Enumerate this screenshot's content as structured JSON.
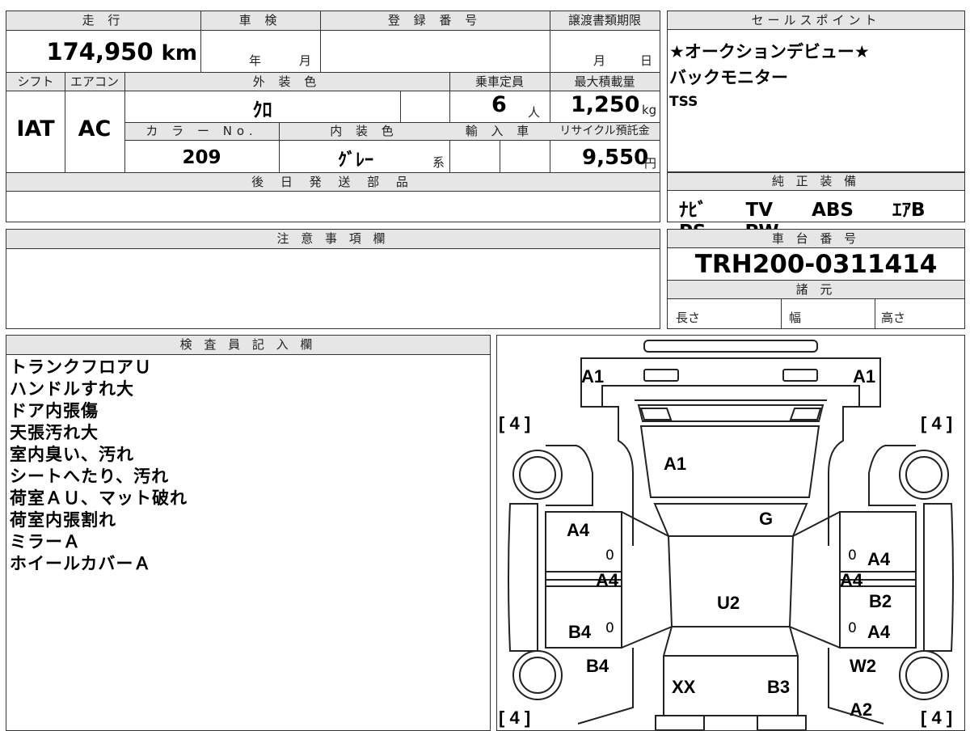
{
  "spec": {
    "mileage_label": "走 行",
    "mileage_value": "174,950",
    "mileage_unit": "km",
    "shaken_label": "車 検",
    "shaken_year": "年",
    "shaken_month": "月",
    "reg_label": "登 録 番 号",
    "deadline_label": "譲渡書類期限",
    "deadline_month": "月",
    "deadline_day": "日",
    "shift_label": "シフト",
    "shift_value": "IAT",
    "ac_label": "エアコン",
    "ac_value": "AC",
    "exterior_label": "外 装 色",
    "exterior_value": "ｸﾛ",
    "seats_label": "乗車定員",
    "seats_value": "6",
    "seats_unit": "人",
    "load_label": "最大積載量",
    "load_value": "1,250",
    "load_unit": "kg",
    "color_no_label": "カ ラ ー No.",
    "color_no_value": "209",
    "interior_label": "内 装 色",
    "interior_value": "ｸﾞﾚｰ",
    "interior_suffix": "系",
    "import_label": "輸 入 車",
    "recycle_label": "リサイクル預託金",
    "recycle_value": "9,550",
    "recycle_unit": "円",
    "later_parts_label": "後 日 発 送 部 品"
  },
  "sales": {
    "label": "セールスポイント",
    "lines": [
      "★オークションデビュー★",
      "バックモニター",
      "TSS"
    ]
  },
  "equipment": {
    "label": "純 正 装 備",
    "items": [
      "ﾅﾋﾞ",
      "TV",
      "ABS",
      "ｴｱB",
      "PS",
      "PW"
    ]
  },
  "notes": {
    "label": "注 意 事 項 欄"
  },
  "chassis": {
    "label": "車 台 番 号",
    "value": "TRH200-0311414",
    "dims_label": "諸 元",
    "length_label": "長さ",
    "width_label": "幅",
    "height_label": "高さ"
  },
  "inspector": {
    "label": "検 査 員 記 入 欄",
    "lines": [
      "トランクフロアＵ",
      "ハンドルすれ大",
      "ドア内張傷",
      "天張汚れ大",
      "室内臭い、汚れ",
      "シートへたり、汚れ",
      "荷室ＡＵ、マット破れ",
      "荷室内張割れ",
      "ミラーＡ",
      "ホイールカバーＡ"
    ]
  },
  "diagram": {
    "tire_tl": "4",
    "tire_tr": "4",
    "tire_bl": "4",
    "tire_br": "4",
    "marks": {
      "bumper_left": "A1",
      "bumper_right": "A1",
      "hood": "A1",
      "windshield": "G",
      "front_fender_left": "A4",
      "front_fender_right": "A4",
      "front_door_left": "A4",
      "front_door_right": "A4",
      "roof": "U2",
      "rear_door_left": "B4",
      "rear_door_right": "B2",
      "rear_door_right_2": "A4",
      "rear_fender_left": "B4",
      "rear_fender_right": "W2",
      "rear_left": "XX",
      "rear_right": "B3",
      "rear_bumper_right": "A2"
    },
    "small_zeros": [
      "0",
      "0",
      "0",
      "0"
    ]
  }
}
